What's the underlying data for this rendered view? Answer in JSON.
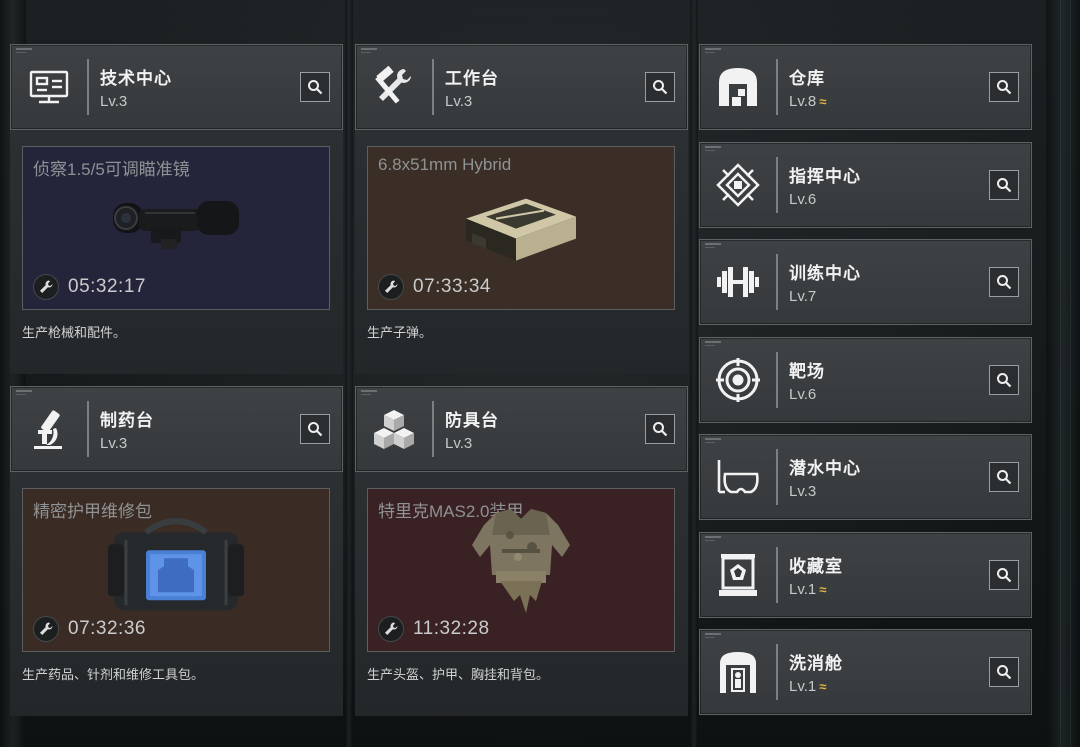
{
  "facilities_left": [
    {
      "name": "技术中心",
      "level": "Lv.3",
      "icon": "tech-monitor-icon",
      "production": {
        "item": "侦察1.5/5可调瞄准镜",
        "time": "05:32:17",
        "desc": "生产枪械和配件。",
        "tint": "#24253a",
        "image": "scope-image"
      }
    },
    {
      "name": "工作台",
      "level": "Lv.3",
      "icon": "hammer-wrench-icon",
      "production": {
        "item": "6.8x51mm Hybrid",
        "time": "07:33:34",
        "desc": "生产子弹。",
        "tint": "#3a2e26",
        "image": "ammo-box-image"
      }
    },
    {
      "name": "制药台",
      "level": "Lv.3",
      "icon": "microscope-icon",
      "production": {
        "item": "精密护甲维修包",
        "time": "07:32:36",
        "desc": "生产药品、针剂和维修工具包。",
        "tint": "#3a2c24",
        "image": "repair-bag-image"
      }
    },
    {
      "name": "防具台",
      "level": "Lv.3",
      "icon": "cubes-icon",
      "production": {
        "item": "特里克MAS2.0装甲",
        "time": "11:32:28",
        "desc": "生产头盔、护甲、胸挂和背包。",
        "tint": "#3a2224",
        "image": "armor-vest-image"
      }
    }
  ],
  "facilities_right": [
    {
      "name": "仓库",
      "level": "Lv.8",
      "upgrade": "≈",
      "icon": "warehouse-icon"
    },
    {
      "name": "指挥中心",
      "level": "Lv.6",
      "upgrade": "",
      "icon": "command-pattern-icon"
    },
    {
      "name": "训练中心",
      "level": "Lv.7",
      "upgrade": "",
      "icon": "dumbbell-icon"
    },
    {
      "name": "靶场",
      "level": "Lv.6",
      "upgrade": "",
      "icon": "target-icon"
    },
    {
      "name": "潜水中心",
      "level": "Lv.3",
      "upgrade": "",
      "icon": "dive-mask-icon"
    },
    {
      "name": "收藏室",
      "level": "Lv.1",
      "upgrade": "≈",
      "icon": "display-case-icon"
    },
    {
      "name": "洗消舱",
      "level": "Lv.1",
      "upgrade": "≈",
      "icon": "decon-chamber-icon"
    }
  ],
  "colors": {
    "upgrade_accent": "#e2b443",
    "panel_border": "#5d6264"
  }
}
